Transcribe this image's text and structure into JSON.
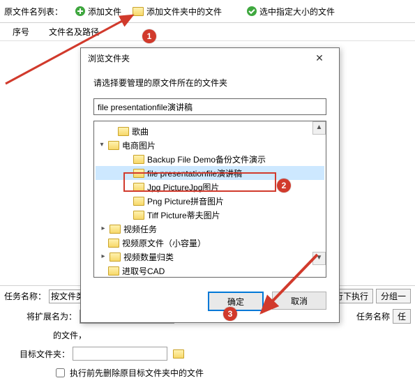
{
  "toolbar": {
    "list_label": "原文件名列表：",
    "add_file": "添加文件",
    "add_folder_files": "添加文件夹中的文件",
    "select_size_files": "选中指定大小的文件"
  },
  "list": {
    "col_num": "序号",
    "col_path": "文件名及路径"
  },
  "task_row": {
    "label": "任务名称：",
    "value": "按文件类型",
    "queue": "行下执行",
    "group": "分组一"
  },
  "ext_row": {
    "label": "将扩展名为：",
    "desc": "的文件，",
    "taskname_label": "任务名称",
    "task_btn": "任"
  },
  "target_row": {
    "label": "目标文件夹："
  },
  "chk_row": {
    "label": "执行前先删除原目标文件夹中的文件"
  },
  "dialog": {
    "title": "浏览文件夹",
    "hint": "请选择要管理的原文件所在的文件夹",
    "path_value": "file presentationfile演讲稿",
    "tree": {
      "songs": "歌曲",
      "ecom": "电商图片",
      "backup": "Backup File Demo备份文件演示",
      "present": "file presentationfile演讲稿",
      "jpg": "Jpg PictureJpg图片",
      "png": "Png Picture拼音图片",
      "tiff": "Tiff Picture蒂夫图片",
      "video": "视频任务",
      "video2": "视频原文件（小容量）",
      "video3": "视频数量归类",
      "cad": "进取号CAD"
    },
    "ok": "确定",
    "cancel": "取消"
  },
  "badges": {
    "b1": "1",
    "b2": "2",
    "b3": "3"
  }
}
